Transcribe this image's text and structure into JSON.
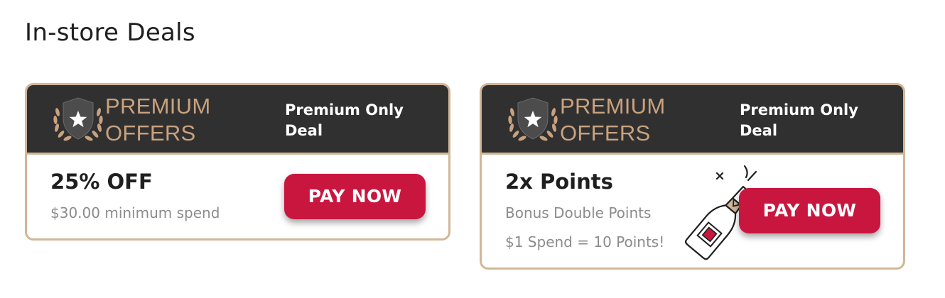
{
  "page": {
    "title": "In-store Deals"
  },
  "deals": [
    {
      "badge": {
        "line1": "PREMIUM",
        "line2": "OFFERS",
        "icon": "shield-star-laurel-icon"
      },
      "tag_line1": "Premium Only",
      "tag_line2": "Deal",
      "title": "25% OFF",
      "subtitle": "$30.00 minimum spend",
      "button_label": "PAY NOW"
    },
    {
      "badge": {
        "line1": "PREMIUM",
        "line2": "OFFERS",
        "icon": "shield-star-laurel-icon"
      },
      "tag_line1": "Premium Only",
      "tag_line2": "Deal",
      "title": "2x Points",
      "subtitle": "Bonus Double Points",
      "detail": "$1 Spend = 10 Points!",
      "button_label": "PAY NOW",
      "illustration": "champagne-bottle-icon"
    }
  ],
  "colors": {
    "header_bg": "#313030",
    "card_border": "#d2b697",
    "premium_gold": "#c8a27f",
    "button_red": "#c9163f",
    "subtitle_gray": "#8c8c8c"
  }
}
